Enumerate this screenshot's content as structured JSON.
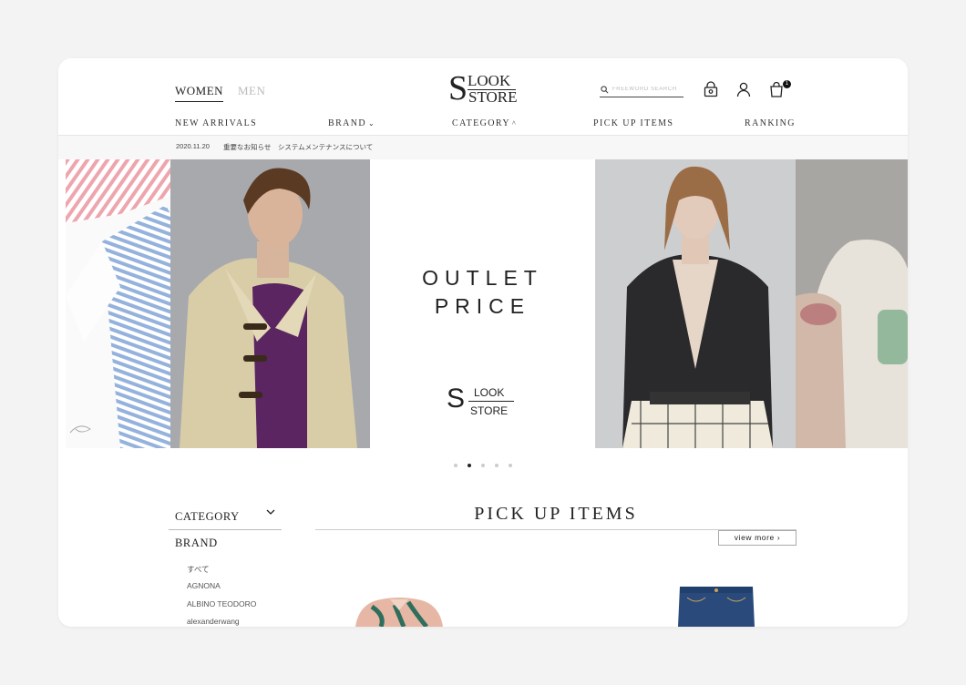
{
  "header": {
    "gender_tabs": [
      "WOMEN",
      "MEN"
    ],
    "logo": {
      "letter": "S",
      "line1": "LOOK",
      "line2": "STORE"
    },
    "search_placeholder": "FREEWORD SEARCH",
    "cart_count": "1",
    "icons": [
      "search-icon",
      "lock-bag-icon",
      "user-icon",
      "cart-icon"
    ]
  },
  "nav": {
    "items": [
      "NEW ARRIVALS",
      "BRAND",
      "CATEGORY",
      "PICK UP ITEMS",
      "RANKING"
    ],
    "brand_chevron": "⌄",
    "category_chevron": "^"
  },
  "news": {
    "date": "2020.11.20",
    "text": "重要なお知らせ　システムメンテナンスについて"
  },
  "hero": {
    "title_line1": "OUTLET",
    "title_line2": "PRICE",
    "logo": {
      "letter": "S",
      "line1": "LOOK",
      "line2": "STORE"
    },
    "slide_count": 5,
    "active_slide": 2
  },
  "sidebar": {
    "category_label": "CATEGORY",
    "brand_label": "BRAND",
    "brands": [
      "すべて",
      "AGNONA",
      "ALBINO TEODORO",
      "alexanderwang"
    ]
  },
  "pickup": {
    "title": "PICK UP ITEMS",
    "view_more": "view more  ›"
  },
  "colors": {
    "accent": "#222222",
    "background": "#f3f3f3",
    "card": "#ffffff"
  }
}
